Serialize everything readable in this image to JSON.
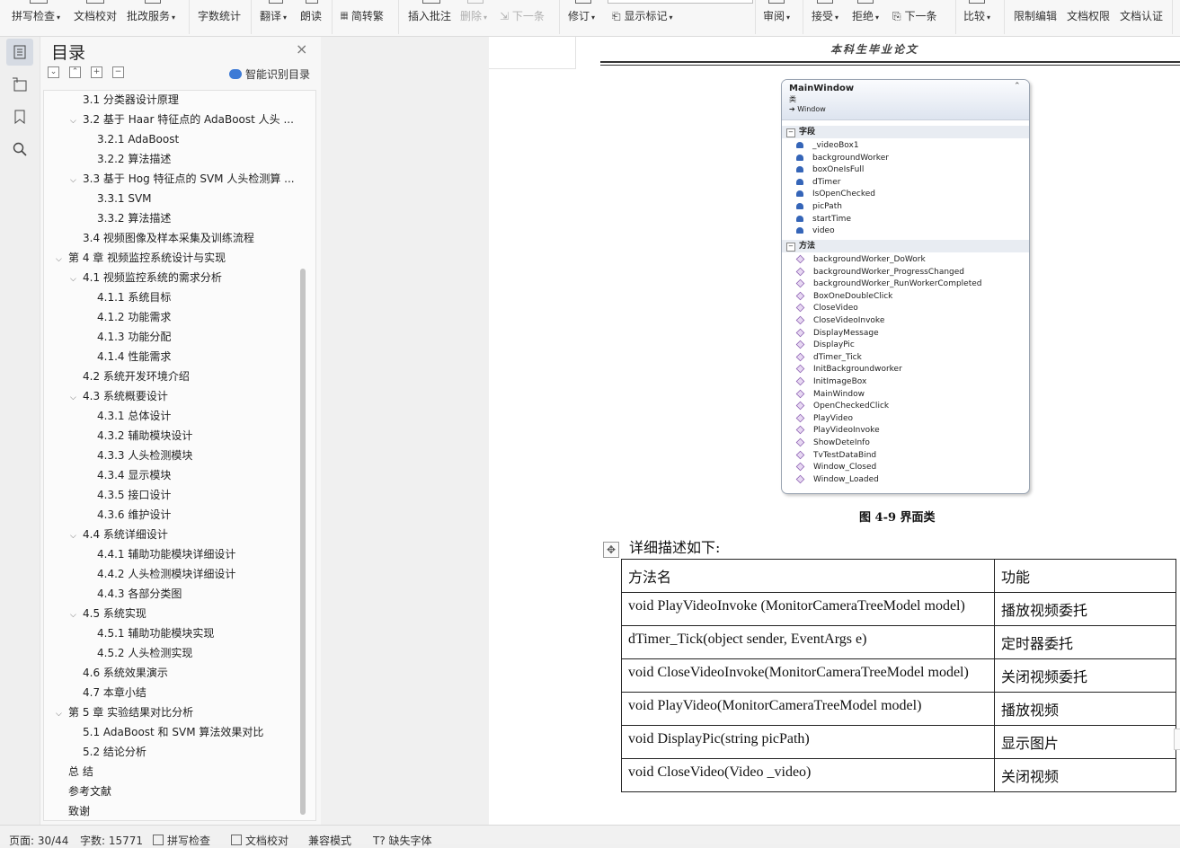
{
  "ribbon": {
    "items": [
      {
        "label": "拼写检查",
        "dropdown": true,
        "state": "normal"
      },
      {
        "label": "文档校对",
        "dropdown": false,
        "state": "normal"
      },
      {
        "label": "批改服务",
        "dropdown": true,
        "state": "normal"
      },
      {
        "label": "字数统计",
        "dropdown": false,
        "state": "normal"
      },
      {
        "label": "翻译",
        "dropdown": true,
        "state": "normal"
      },
      {
        "label": "朗读",
        "dropdown": false,
        "state": "normal"
      },
      {
        "label": "简转繁",
        "dropdown": false,
        "state": "normal"
      },
      {
        "label": "插入批注",
        "dropdown": false,
        "state": "normal"
      },
      {
        "label": "删除",
        "dropdown": true,
        "state": "disabled"
      },
      {
        "label": "下一条",
        "dropdown": false,
        "state": "disabled"
      },
      {
        "label": "修订",
        "dropdown": true,
        "state": "normal"
      },
      {
        "label": "显示标记",
        "dropdown": true,
        "state": "normal"
      },
      {
        "label": "审阅",
        "dropdown": true,
        "state": "normal"
      },
      {
        "label": "接受",
        "dropdown": true,
        "state": "normal"
      },
      {
        "label": "拒绝",
        "dropdown": true,
        "state": "normal"
      },
      {
        "label": "下一条",
        "dropdown": false,
        "state": "normal"
      },
      {
        "label": "比较",
        "dropdown": true,
        "state": "normal"
      },
      {
        "label": "限制编辑",
        "dropdown": false,
        "state": "normal"
      },
      {
        "label": "文档权限",
        "dropdown": false,
        "state": "normal"
      },
      {
        "label": "文档认证",
        "dropdown": false,
        "state": "normal"
      }
    ]
  },
  "sidebar_icons": [
    "toc-icon",
    "selection-pane-icon",
    "bookmark-icon",
    "search-icon"
  ],
  "nav": {
    "title": "目录",
    "close_glyph": "×",
    "tools": [
      "collapse-all",
      "expand-all",
      "add-entry",
      "remove-entry"
    ],
    "smart_label": "智能识别目录",
    "toc": [
      {
        "text": "3.1  分类器设计原理",
        "level": 2,
        "toggle": ""
      },
      {
        "text": "3.2  基于 Haar 特征点的 AdaBoost 人头 ...",
        "level": 2,
        "toggle": "v"
      },
      {
        "text": "3.2.1 AdaBoost",
        "level": 3,
        "toggle": ""
      },
      {
        "text": "3.2.2  算法描述",
        "level": 3,
        "toggle": ""
      },
      {
        "text": "3.3  基于 Hog 特征点的 SVM 人头检测算 ...",
        "level": 2,
        "toggle": "v"
      },
      {
        "text": "3.3.1 SVM",
        "level": 3,
        "toggle": ""
      },
      {
        "text": "3.3.2  算法描述",
        "level": 3,
        "toggle": ""
      },
      {
        "text": "3.4  视频图像及样本采集及训练流程",
        "level": 2,
        "toggle": ""
      },
      {
        "text": "第 4 章   视频监控系统设计与实现",
        "level": 1,
        "toggle": "v"
      },
      {
        "text": "4.1    视频监控系统的需求分析",
        "level": 2,
        "toggle": "v"
      },
      {
        "text": "4.1.1  系统目标",
        "level": 3,
        "toggle": ""
      },
      {
        "text": "4.1.2  功能需求",
        "level": 3,
        "toggle": ""
      },
      {
        "text": "4.1.3  功能分配",
        "level": 3,
        "toggle": ""
      },
      {
        "text": "4.1.4  性能需求",
        "level": 3,
        "toggle": ""
      },
      {
        "text": "4.2  系统开发环境介绍",
        "level": 2,
        "toggle": ""
      },
      {
        "text": "4.3 系统概要设计",
        "level": 2,
        "toggle": "v"
      },
      {
        "text": "4.3.1  总体设计",
        "level": 3,
        "toggle": ""
      },
      {
        "text": "4.3.2  辅助模块设计",
        "level": 3,
        "toggle": ""
      },
      {
        "text": "4.3.3  人头检测模块",
        "level": 3,
        "toggle": ""
      },
      {
        "text": "4.3.4  显示模块",
        "level": 3,
        "toggle": ""
      },
      {
        "text": "4.3.5  接口设计",
        "level": 3,
        "toggle": ""
      },
      {
        "text": "4.3.6 维护设计",
        "level": 3,
        "toggle": ""
      },
      {
        "text": "4.4  系统详细设计",
        "level": 2,
        "toggle": "v"
      },
      {
        "text": "4.4.1  辅助功能模块详细设计",
        "level": 3,
        "toggle": ""
      },
      {
        "text": "4.4.2  人头检测模块详细设计",
        "level": 3,
        "toggle": ""
      },
      {
        "text": "4.4.3  各部分类图",
        "level": 3,
        "toggle": ""
      },
      {
        "text": "4.5  系统实现",
        "level": 2,
        "toggle": "v"
      },
      {
        "text": "4.5.1  辅助功能模块实现",
        "level": 3,
        "toggle": ""
      },
      {
        "text": "4.5.2 人头检测实现",
        "level": 3,
        "toggle": ""
      },
      {
        "text": "4.6  系统效果演示",
        "level": 2,
        "toggle": ""
      },
      {
        "text": "4.7 本章小结",
        "level": 2,
        "toggle": ""
      },
      {
        "text": "第 5 章   实验结果对比分析",
        "level": 1,
        "toggle": "v"
      },
      {
        "text": "5.1 AdaBoost 和 SVM 算法效果对比",
        "level": 2,
        "toggle": ""
      },
      {
        "text": "5.2 结论分析",
        "level": 2,
        "toggle": ""
      },
      {
        "text": "总  结",
        "level": 1,
        "toggle": ""
      },
      {
        "text": "参考文献",
        "level": 1,
        "toggle": ""
      },
      {
        "text": "致谢",
        "level": 1,
        "toggle": ""
      }
    ]
  },
  "doc": {
    "header_text": "本科生毕业论文",
    "class_diagram": {
      "name": "MainWindow",
      "kind": "类",
      "base": "➔ Window",
      "fields_label": "字段",
      "fields": [
        "_videoBox1",
        "backgroundWorker",
        "boxOneIsFull",
        "dTimer",
        "IsOpenChecked",
        "picPath",
        "startTime",
        "video"
      ],
      "methods_label": "方法",
      "methods": [
        "backgroundWorker_DoWork",
        "backgroundWorker_ProgressChanged",
        "backgroundWorker_RunWorkerCompleted",
        "BoxOneDoubleClick",
        "CloseVideo",
        "CloseVideoInvoke",
        "DisplayMessage",
        "DisplayPic",
        "dTimer_Tick",
        "InitBackgroundworker",
        "InitImageBox",
        "MainWindow",
        "OpenCheckedClick",
        "PlayVideo",
        "PlayVideoInvoke",
        "ShowDeteInfo",
        "TvTestDataBind",
        "Window_Closed",
        "Window_Loaded"
      ]
    },
    "caption": "图 4-9    界面类",
    "intro": "详细描述如下:",
    "table": {
      "headers": [
        "方法名",
        "功能"
      ],
      "rows": [
        [
          "void    PlayVideoInvoke    (MonitorCameraTreeModel model)",
          "播放视频委托"
        ],
        [
          "dTimer_Tick(object sender, EventArgs e)",
          "定时器委托"
        ],
        [
          "void     CloseVideoInvoke(MonitorCameraTreeModel model)",
          "关闭视频委托"
        ],
        [
          "void PlayVideo(MonitorCameraTreeModel model)",
          "播放视频"
        ],
        [
          "void DisplayPic(string picPath)",
          "显示图片"
        ],
        [
          "void CloseVideo(Video _video)",
          "关闭视频"
        ]
      ]
    }
  },
  "statusbar": {
    "page": "页面: 30/44",
    "words": "字数: 15771",
    "spell": "拼写检查",
    "proof": "文档校对",
    "compat": "兼容模式",
    "missing_font": "缺失字体"
  }
}
